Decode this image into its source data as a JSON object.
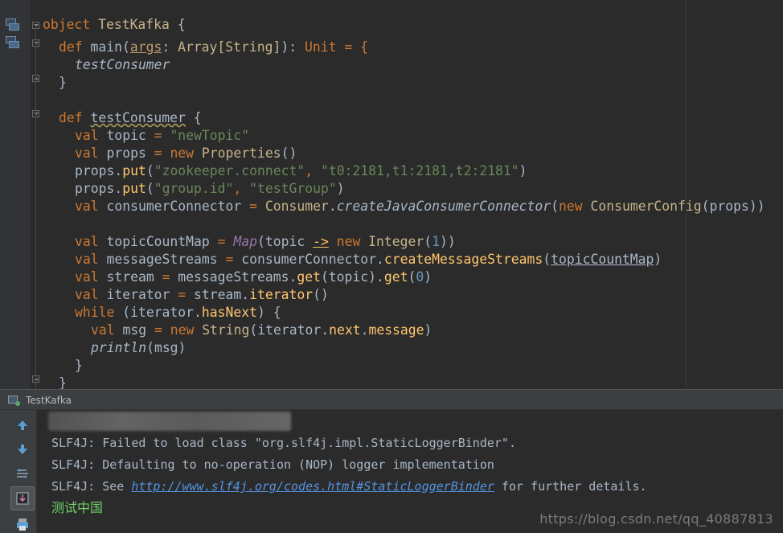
{
  "editor": {
    "lines": {
      "l1": {
        "kw_object": "object",
        "cls_name": "TestKafka",
        "brace": " {"
      },
      "l2": {
        "kw_def": "def",
        "fn": "main",
        "open": "(",
        "param": "args",
        "colon": ": ",
        "type": "Array[String]",
        "close": "): ",
        "ret": "Unit",
        "eq": " = {"
      },
      "l3": {
        "call": "testConsumer"
      },
      "l4": {
        "brace": "}"
      },
      "l6": {
        "kw_def": "def",
        "fn": "testConsumer",
        "brace": " {"
      },
      "l7": {
        "kw_val": "val",
        "name": " topic ",
        "eq": "=",
        "str": "\"newTopic\""
      },
      "l8": {
        "kw_val": "val",
        "name": " props ",
        "eq": "=",
        "kw_new": "new",
        "type": "Properties",
        "rest": "()"
      },
      "l9": {
        "obj": "props.",
        "meth": "put",
        "open": "(",
        "s1": "\"zookeeper.connect\"",
        "comma": ", ",
        "s2": "\"t0:2181,t1:2181,t2:2181\"",
        "close": ")"
      },
      "l10": {
        "obj": "props.",
        "meth": "put",
        "open": "(",
        "s1": "\"group.id\"",
        "comma": ", ",
        "s2": "\"testGroup\"",
        "close": ")"
      },
      "l11": {
        "kw_val": "val",
        "name": " consumerConnector ",
        "eq": "=",
        "type1": "Consumer",
        "dot": ".",
        "meth": "createJavaConsumerConnector",
        "open": "(",
        "kw_new": "new",
        "type2": "ConsumerConfig",
        "rest": "(props))"
      },
      "l13": {
        "kw_val": "val",
        "name": " topicCountMap ",
        "eq": "=",
        "map": "Map",
        "open": "(topic ",
        "arrow": "->",
        "kw_new": "new",
        "type": "Integer",
        "p1": "(",
        "num": "1",
        "p2": "))"
      },
      "l14": {
        "kw_val": "val",
        "name": " messageStreams ",
        "eq": "=",
        "obj": " consumerConnector.",
        "meth": "createMessageStreams",
        "open": "(",
        "arg": "topicCountMap",
        "close": ")"
      },
      "l15": {
        "kw_val": "val",
        "name": " stream ",
        "eq": "=",
        "obj": " messageStreams.",
        "m1": "get",
        "mid": "(topic).",
        "m2": "get",
        "p1": "(",
        "num": "0",
        "p2": ")"
      },
      "l16": {
        "kw_val": "val",
        "name": " iterator ",
        "eq": "=",
        "obj": " stream.",
        "meth": "iterator",
        "rest": "()"
      },
      "l17": {
        "kw_while": "while",
        "open": " (iterator.",
        "meth": "hasNext",
        "rest": ") {"
      },
      "l18": {
        "kw_val": "val",
        "name": " msg ",
        "eq": "=",
        "kw_new": "new",
        "type": "String",
        "open": "(iterator.",
        "m1": "next",
        "dot": ".",
        "m2": "message",
        "close": ")"
      },
      "l19": {
        "call": "println",
        "rest": "(msg)"
      },
      "l20": {
        "brace": "}"
      },
      "l21": {
        "brace": "}"
      }
    }
  },
  "run_panel": {
    "tab_label": "TestKafka",
    "console": {
      "line1": "SLF4J: Failed to load class \"org.slf4j.impl.StaticLoggerBinder\".",
      "line2": "SLF4J: Defaulting to no-operation (NOP) logger implementation",
      "line3_prefix": "SLF4J: See ",
      "line3_link": "http://www.slf4j.org/codes.html#StaticLoggerBinder",
      "line3_suffix": " for further details.",
      "line4": "测试中国"
    },
    "toolbar": {
      "icons": [
        "arrow-up-icon",
        "arrow-down-icon",
        "soft-wrap-icon",
        "scroll-to-end-icon",
        "print-icon"
      ]
    }
  },
  "watermark": "https://blog.csdn.net/qq_40887813",
  "colors": {
    "editor_bg": "#2b2b2b",
    "keyword": "#cc7832",
    "string": "#6a8759",
    "number": "#6897bb",
    "method": "#ffc66d",
    "link": "#5494e3",
    "chinese_output": "#6fcf68"
  }
}
